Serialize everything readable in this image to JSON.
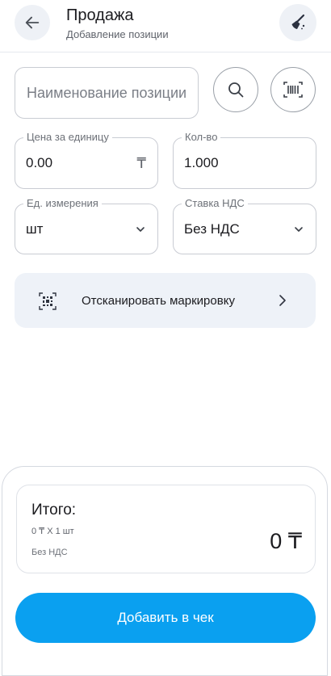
{
  "header": {
    "title": "Продажа",
    "subtitle": "Добавление позиции",
    "back_icon": "arrow-left-icon",
    "clear_icon": "broom-icon"
  },
  "form": {
    "name": {
      "placeholder": "Наименование позиции",
      "value": ""
    },
    "search_icon": "search-icon",
    "barcode_icon": "barcode-scan-icon",
    "price": {
      "label": "Цена за единицу",
      "value": "0.00",
      "currency": "₸"
    },
    "qty": {
      "label": "Кол-во",
      "value": "1.000"
    },
    "unit": {
      "label": "Ед. измерения",
      "value": "шт"
    },
    "vat": {
      "label": "Ставка НДС",
      "value": "Без НДС"
    }
  },
  "scan_marking": {
    "label": "Отсканировать маркировку",
    "icon": "datamatrix-scan-icon"
  },
  "summary": {
    "title": "Итого:",
    "line": "0 ₸ X 1 шт",
    "vat": "Без НДС",
    "amount": "0 ₸"
  },
  "add_button": {
    "label": "Добавить в чек"
  },
  "colors": {
    "accent": "#0aa0f0",
    "field_border": "#c9ccd3",
    "scan_bg": "#eef2f8",
    "icon_bg": "#eef1f6"
  }
}
